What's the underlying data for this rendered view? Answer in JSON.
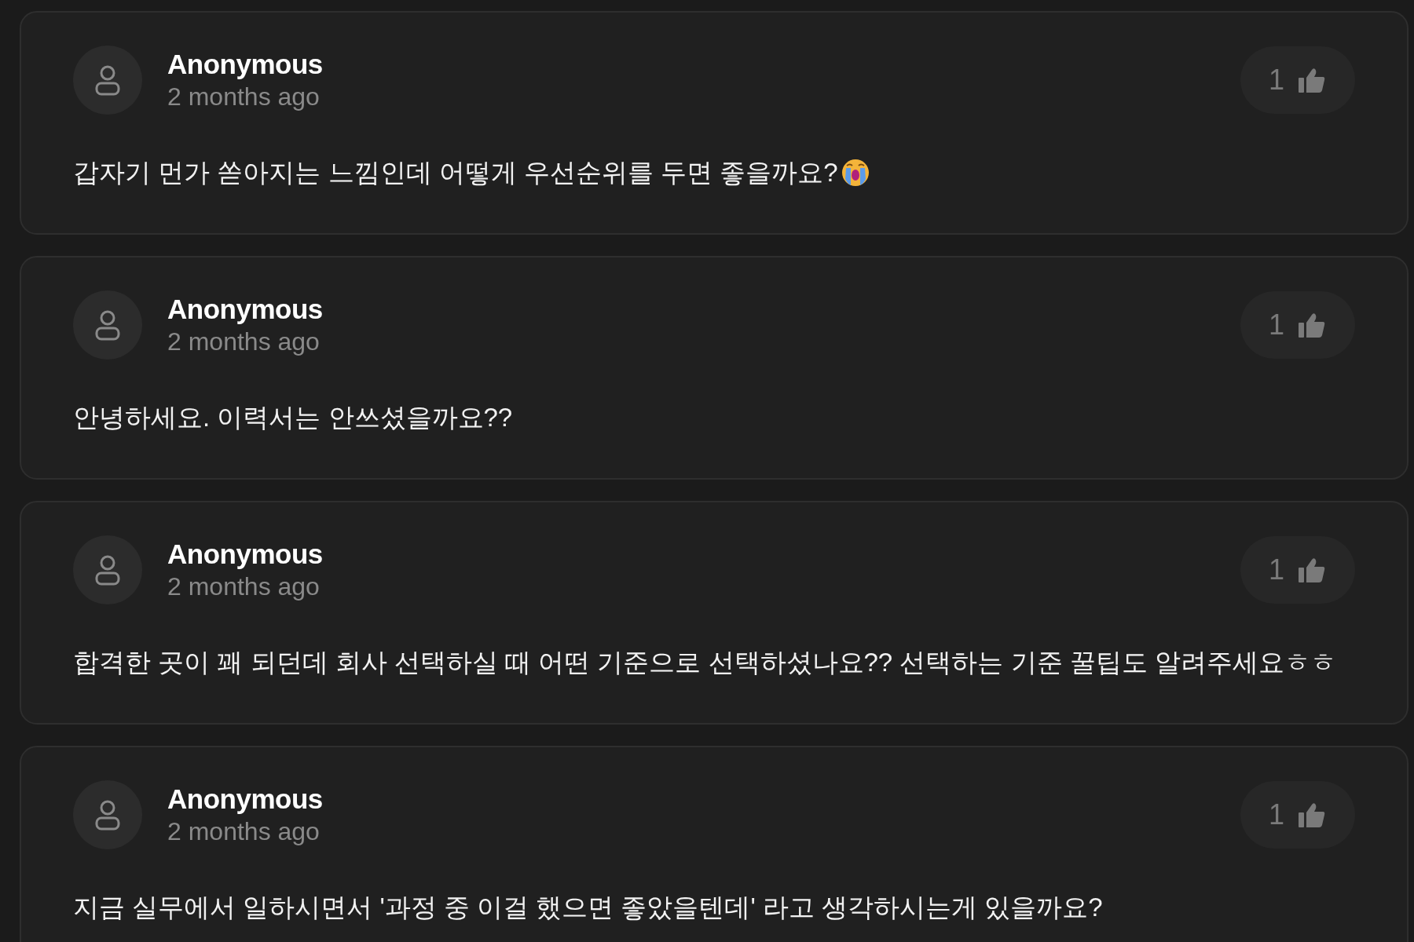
{
  "comments": [
    {
      "author": "Anonymous",
      "time": "2 months ago",
      "likes": "1",
      "text": "갑자기 먼가 쏟아지는 느낌인데 어떻게 우선순위를 두면 좋을까요?",
      "emoji_icon": true
    },
    {
      "author": "Anonymous",
      "time": "2 months ago",
      "likes": "1",
      "text": "안녕하세요. 이력서는 안쓰셨을까요??",
      "emoji_icon": false
    },
    {
      "author": "Anonymous",
      "time": "2 months ago",
      "likes": "1",
      "text": "합격한 곳이 꽤 되던데 회사 선택하실 때 어떤 기준으로 선택하셨나요?? 선택하는 기준 꿀팁도 알려주세요ㅎㅎ",
      "emoji_icon": false
    },
    {
      "author": "Anonymous",
      "time": "2 months ago",
      "likes": "1",
      "text": "지금 실무에서 일하시면서 '과정 중 이걸 했으면 좋았을텐데' 라고 생각하시는게 있을까요?",
      "emoji_icon": false
    }
  ]
}
